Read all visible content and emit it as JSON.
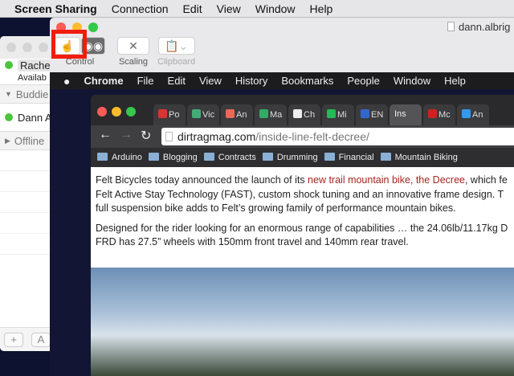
{
  "menubar": {
    "app": "Screen Sharing",
    "items": [
      "Connection",
      "Edit",
      "View",
      "Window",
      "Help"
    ]
  },
  "messages": {
    "user": "Rache",
    "status": "Availab",
    "group1": "Buddie",
    "buddy": "Dann A",
    "group2": "Offline",
    "add_label": "+",
    "a_label": "A"
  },
  "screen_sharing": {
    "title": "dann.albrig",
    "tools": [
      {
        "label": "Control"
      },
      {
        "label": "Scaling"
      },
      {
        "label": "Clipboard"
      }
    ]
  },
  "remote_menu": {
    "apple": "",
    "app": "Chrome",
    "items": [
      "File",
      "Edit",
      "View",
      "History",
      "Bookmarks",
      "People",
      "Window",
      "Help"
    ]
  },
  "chrome": {
    "tabs": [
      {
        "label": "Po",
        "color": "#d33"
      },
      {
        "label": "Vic",
        "color": "#4a7"
      },
      {
        "label": "An",
        "color": "#e65"
      },
      {
        "label": "Ma",
        "color": "#3a6"
      },
      {
        "label": "Ch",
        "color": "#eee"
      },
      {
        "label": "Mi",
        "color": "#2b5"
      },
      {
        "label": "EN",
        "color": "#36c"
      },
      {
        "label": "Ins",
        "color": "",
        "active": true
      },
      {
        "label": "Mc",
        "color": "#c22"
      },
      {
        "label": "An",
        "color": "#39e"
      }
    ],
    "url_domain": "dirtragmag.com",
    "url_path": "/inside-line-felt-decree/",
    "bookmarks": [
      "Arduino",
      "Blogging",
      "Contracts",
      "Drumming",
      "Financial",
      "Mountain Biking"
    ],
    "p1a": "Felt Bicycles today announced the launch of its ",
    "p1link": "new trail mountain bike, the Decree",
    ", which fe": "",
    "p1b": ", which fe",
    "p1c": "Felt Active Stay Technology (FAST), custom shock tuning and an innovative frame design. T",
    "p1d": "full suspension bike adds to Felt’s growing family of performance mountain bikes.",
    "p2a": "Designed for the rider looking for an enormous range of capabilities … the 24.06lb/11.17kg D",
    "p2b": "FRD has 27.5” wheels with 150mm front travel and 140mm rear travel."
  }
}
